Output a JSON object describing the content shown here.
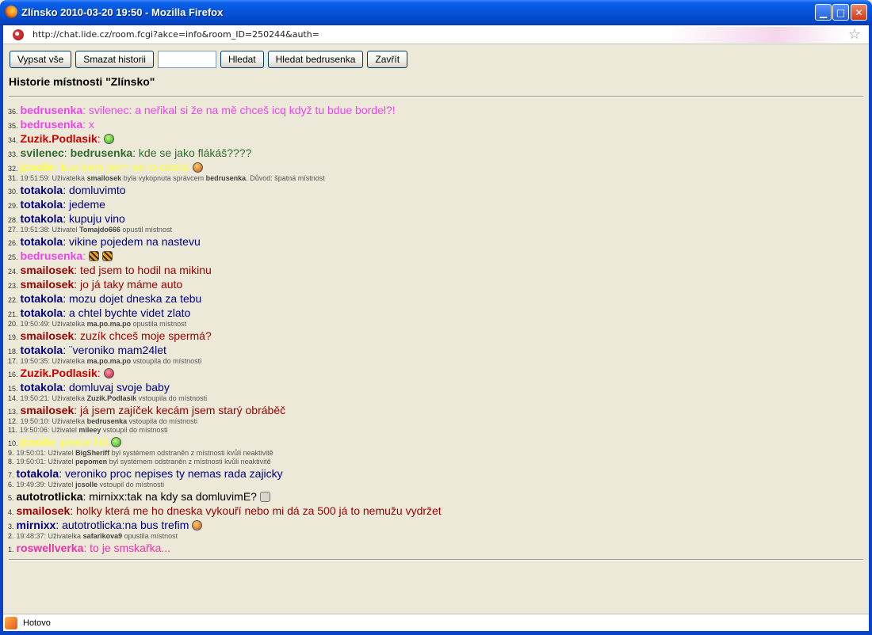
{
  "window": {
    "title": "Zlínsko 2010-03-20 19:50 - Mozilla Firefox",
    "min_glyph": "▁",
    "max_glyph": "□",
    "close_glyph": "✕"
  },
  "address": {
    "url": "http://chat.lide.cz/room.fcgi?akce=info&room_ID=250244&auth=",
    "star_glyph": "☆"
  },
  "toolbar": {
    "list_all": "Vypsat vše",
    "clear_history": "Smazat historii",
    "search_value": "",
    "search": "Hledat",
    "search_user": "Hledat bedrusenka",
    "close": "Zavřít"
  },
  "page": {
    "title": "Historie místnosti \"Zlínsko\""
  },
  "colors": {
    "bedrusenka": "#ee44ee",
    "zuzik": "#cc0000",
    "svilenec": "#2e6b2e",
    "jcsolle": "#ffff33",
    "totakola": "#000080",
    "smailosek": "#990000",
    "autotrotlicka": "#000000",
    "mirnixx": "#000080",
    "roswellverka": "#ee33aa"
  },
  "history": [
    {
      "type": "msg",
      "num": "36.",
      "nick": "bedrusenka",
      "text": ": svilenec: a neřikal si že na mě chceš icq když tu bdue bordel?!",
      "color": "#ee44ee"
    },
    {
      "type": "msg",
      "num": "35.",
      "nick": "bedrusenka",
      "text": ": x",
      "color": "#ee44ee"
    },
    {
      "type": "msg",
      "num": "34.",
      "nick": "Zuzik.Podlasik",
      "text": ":",
      "color": "#cc0000",
      "emoji": "green"
    },
    {
      "type": "msg",
      "num": "33.",
      "nick": "svilenec",
      "text": ": ",
      "color": "#2e6b2e",
      "extra_nick": "bedrusenka",
      "extra_text": ": kde se jako flákáš????"
    },
    {
      "type": "msg",
      "num": "32.",
      "nick": "jcsolle",
      "text": ": kua kam jsem se to dostal",
      "color": "#ffff33",
      "emoji": "orange"
    },
    {
      "type": "sys",
      "num": "31.",
      "pre": "19:51:59: Uživatelka ",
      "b1": "smailosek",
      "mid": " byla vykopnuta správcem ",
      "b2": "bedrusenka",
      "post": ". Důvod: špatná místnost"
    },
    {
      "type": "msg",
      "num": "30.",
      "nick": "totakola",
      "text": ": domluvimto",
      "color": "#000080"
    },
    {
      "type": "msg",
      "num": "29.",
      "nick": "totakola",
      "text": ": jedeme",
      "color": "#000080"
    },
    {
      "type": "msg",
      "num": "28.",
      "nick": "totakola",
      "text": ": kupuju vino",
      "color": "#000080"
    },
    {
      "type": "sys",
      "num": "27.",
      "pre": "19:51:38: Uživatel ",
      "b1": "Tomajdo666",
      "mid": " opustil místnost",
      "b2": "",
      "post": ""
    },
    {
      "type": "msg",
      "num": "26.",
      "nick": "totakola",
      "text": ": vikine pojedem na nastevu",
      "color": "#000080"
    },
    {
      "type": "msg",
      "num": "25.",
      "nick": "bedrusenka",
      "text": ":",
      "color": "#ee44ee",
      "emoji": "tiger",
      "emoji2": "tiger"
    },
    {
      "type": "msg",
      "num": "24.",
      "nick": "smailosek",
      "text": ": ted jsem to hodil na mikinu",
      "color": "#990000"
    },
    {
      "type": "msg",
      "num": "23.",
      "nick": "smailosek",
      "text": ": jo já taky máme auto",
      "color": "#990000"
    },
    {
      "type": "msg",
      "num": "22.",
      "nick": "totakola",
      "text": ": mozu dojet dneska za tebu",
      "color": "#000080"
    },
    {
      "type": "msg",
      "num": "21.",
      "nick": "totakola",
      "text": ": a chtel bychte videt zlato",
      "color": "#000080"
    },
    {
      "type": "sys",
      "num": "20.",
      "pre": "19:50:49: Uživatelka ",
      "b1": "ma.po.ma.po",
      "mid": " opustila místnost",
      "b2": "",
      "post": ""
    },
    {
      "type": "msg",
      "num": "19.",
      "nick": "smailosek",
      "text": ": zuzík chceš moje spermá?",
      "color": "#990000"
    },
    {
      "type": "msg",
      "num": "18.",
      "nick": "totakola",
      "text": ": ¨veroniko mam24let",
      "color": "#000080"
    },
    {
      "type": "sys",
      "num": "17.",
      "pre": "19:50:35: Uživatelka ",
      "b1": "ma.po.ma.po",
      "mid": " vstoupila do místnosti",
      "b2": "",
      "post": ""
    },
    {
      "type": "msg",
      "num": "16.",
      "nick": "Zuzik.Podlasik",
      "text": ":",
      "color": "#cc0000",
      "emoji": "red"
    },
    {
      "type": "msg",
      "num": "15.",
      "nick": "totakola",
      "text": ": domluvaj svoje baby",
      "color": "#000080"
    },
    {
      "type": "sys",
      "num": "14.",
      "pre": "19:50:21: Uživatelka ",
      "b1": "Zuzik.Podlasik",
      "mid": " vstoupila do místnosti",
      "b2": "",
      "post": ""
    },
    {
      "type": "msg",
      "num": "13.",
      "nick": "smailosek",
      "text": ": já jsem zajíček kecám jsem starý obráběč",
      "color": "#990000"
    },
    {
      "type": "sys",
      "num": "12.",
      "pre": "19:50:10: Uživatelka ",
      "b1": "bedrusenka",
      "mid": " vstoupila do místnosti",
      "b2": "",
      "post": ""
    },
    {
      "type": "sys",
      "num": "11.",
      "pre": "19:50:06: Uživatel ",
      "b1": "mileey",
      "mid": " vstoupil do místnosti",
      "b2": "",
      "post": ""
    },
    {
      "type": "msg",
      "num": "10.",
      "nick": "jcsolle",
      "text": ": peace lidi",
      "color": "#ffff33",
      "emoji": "green"
    },
    {
      "type": "sys",
      "num": "9.",
      "pre": "19:50:01: Uživatel ",
      "b1": "BigSheriff",
      "mid": " byl systémem odstraněn z místnosti kvůli neaktivitě",
      "b2": "",
      "post": ""
    },
    {
      "type": "sys",
      "num": "8.",
      "pre": "19:50:01: Uživatel ",
      "b1": "pepomen",
      "mid": " byl systémem odstraněn z místnosti kvůli neaktivitě",
      "b2": "",
      "post": ""
    },
    {
      "type": "msg",
      "num": "7.",
      "nick": "totakola",
      "text": ": veroniko proc nepises ty nemas rada zajicky",
      "color": "#000080"
    },
    {
      "type": "sys",
      "num": "6.",
      "pre": "19:49:39: Uživatel ",
      "b1": "jcsolle",
      "mid": " vstoupil do místnosti",
      "b2": "",
      "post": ""
    },
    {
      "type": "msg",
      "num": "5.",
      "nick": "autotrotlicka",
      "text": ": mirnixx:tak na kdy sa domluvimE?",
      "color": "#000000",
      "emoji": "hand"
    },
    {
      "type": "msg",
      "num": "4.",
      "nick": "smailosek",
      "text": ": holky která me ho dneska vykouří nebo mi dá za 500 já to nemužu vydržet",
      "color": "#990000"
    },
    {
      "type": "msg",
      "num": "3.",
      "nick": "mirnixx",
      "text": ": autotrotlicka:na bus trefim",
      "color": "#000080",
      "emoji": "orange"
    },
    {
      "type": "sys",
      "num": "2.",
      "pre": "19:48:37: Uživatelka ",
      "b1": "safarikova9",
      "mid": " opustila místnost",
      "b2": "",
      "post": ""
    },
    {
      "type": "msg",
      "num": "1.",
      "nick": "roswellverka",
      "text": ": to je smskařka...",
      "color": "#ee33aa"
    }
  ],
  "status": {
    "text": "Hotovo"
  }
}
